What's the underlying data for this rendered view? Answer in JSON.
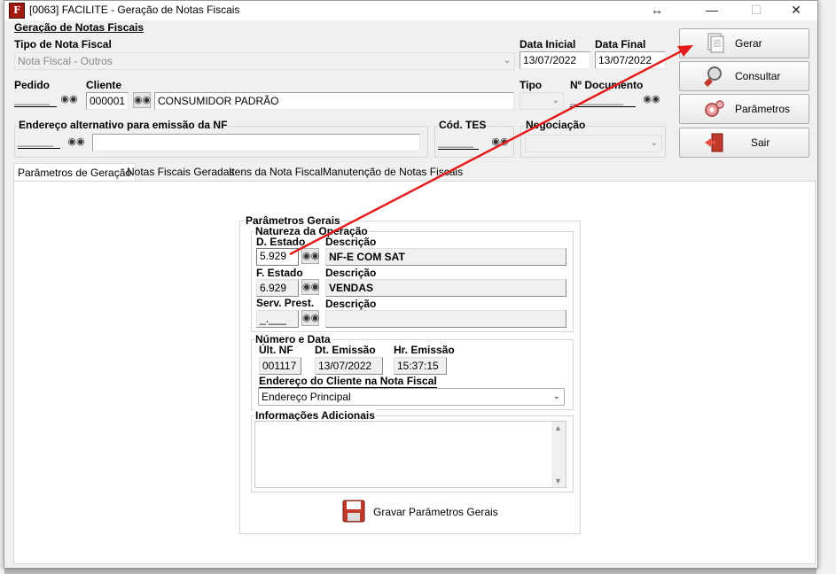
{
  "window": {
    "title": "[0063] FACILITE - Geração de Notas Fiscais",
    "app_icon_letter": "F"
  },
  "header": {
    "section_title": "Geração de Notas Fiscais",
    "tipo_nota_label": "Tipo de Nota Fiscal",
    "tipo_nota_value": "Nota Fiscal - Outros",
    "data_inicial_label": "Data Inicial",
    "data_inicial_value": "13/07/2022",
    "data_final_label": "Data Final",
    "data_final_value": "13/07/2022",
    "pedido_label": "Pedido",
    "pedido_value": "______",
    "cliente_label": "Cliente",
    "cliente_code": "000001",
    "cliente_name": "CONSUMIDOR PADRÃO",
    "tipo_label": "Tipo",
    "ndoc_label": "Nº Documento",
    "ndoc_value": "_________",
    "endereco_alt_label": "Endereço alternativo para emissão da NF",
    "endereco_alt_code": "______",
    "cod_tes_label": "Cód. TES",
    "cod_tes_value": "______",
    "negociacao_label": "Negociação"
  },
  "buttons": {
    "gerar": "Gerar",
    "consultar": "Consultar",
    "parametros": "Parâmetros",
    "sair": "Sair"
  },
  "tabs": [
    {
      "label": "Parâmetros de Geração"
    },
    {
      "label": "Notas Fiscais Geradas"
    },
    {
      "label": "Itens da Nota Fiscal"
    },
    {
      "label": "Manutenção de Notas Fiscais"
    }
  ],
  "params": {
    "group_title": "Parâmetros Gerais",
    "natureza_title": "Natureza da Operação",
    "d_estado_label": "D. Estado",
    "d_estado_value": "5.929",
    "d_desc_label": "Descrição",
    "d_desc_value": "NF-E COM SAT",
    "f_estado_label": "F. Estado",
    "f_estado_value": "6.929",
    "f_desc_label": "Descrição",
    "f_desc_value": "VENDAS",
    "serv_label": "Serv. Prest.",
    "serv_value": "_.___",
    "serv_desc_label": "Descrição",
    "numero_title": "Número e Data",
    "ult_nf_label": "Últ. NF",
    "ult_nf_value": "001117",
    "dt_emissao_label": "Dt. Emissão",
    "dt_emissao_value": "13/07/2022",
    "hr_emissao_label": "Hr. Emissão",
    "hr_emissao_value": "15:37:15",
    "endereco_cliente_label": "Endereço do Cliente na Nota Fiscal",
    "endereco_cliente_value": "Endereço Principal",
    "info_title": "Informações Adicionais",
    "gravar_label": "Gravar Parâmetros Gerais"
  },
  "colors": {
    "annotation_arrow": "#e51c1c",
    "window_bg": "#f0f0f0"
  }
}
